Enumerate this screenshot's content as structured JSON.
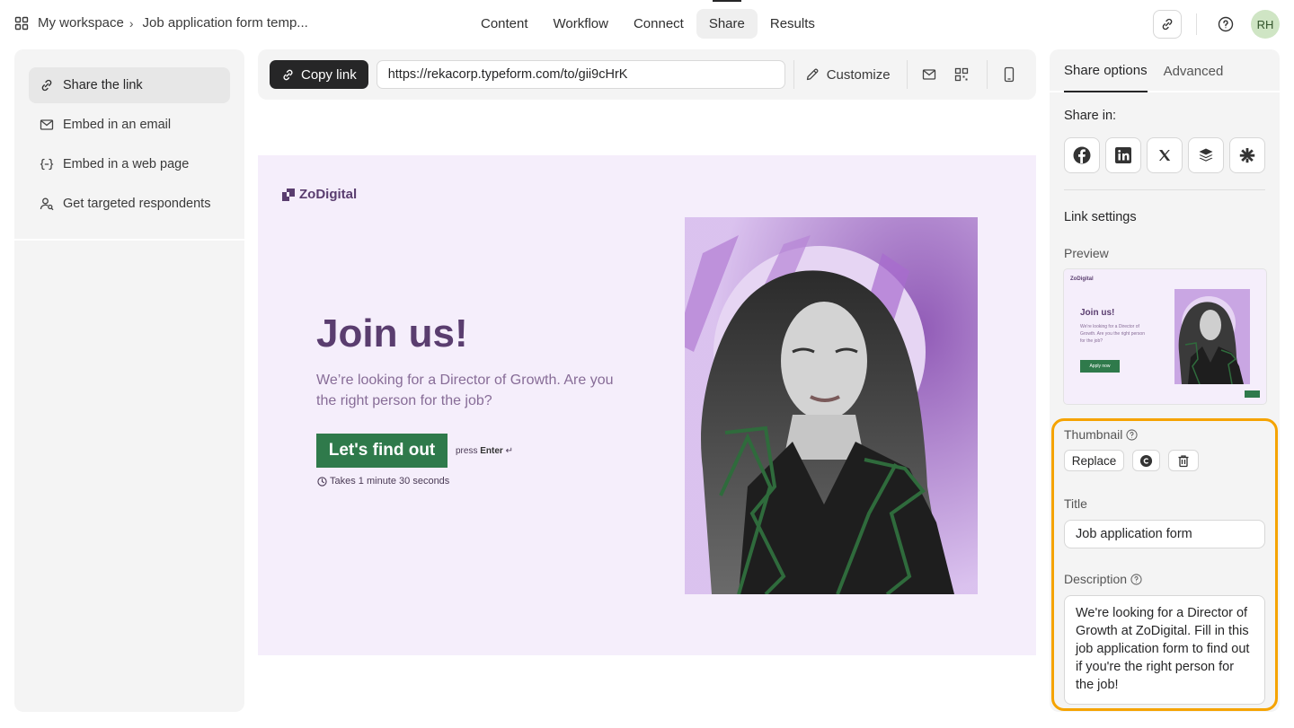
{
  "breadcrumb": {
    "workspace": "My workspace",
    "form": "Job application form temp..."
  },
  "topnav": {
    "tabs": [
      "Content",
      "Workflow",
      "Connect",
      "Share",
      "Results"
    ],
    "active": "Share"
  },
  "user": {
    "initials": "RH"
  },
  "left_menu": {
    "items": [
      {
        "label": "Share the link",
        "icon": "link-icon",
        "active": true
      },
      {
        "label": "Embed in an email",
        "icon": "mail-icon"
      },
      {
        "label": "Embed in a web page",
        "icon": "code-braces-icon"
      },
      {
        "label": "Get targeted respondents",
        "icon": "user-search-icon"
      }
    ]
  },
  "linkbar": {
    "copy_label": "Copy link",
    "url": "https://rekacorp.typeform.com/to/gii9cHrK",
    "customize_label": "Customize"
  },
  "form_preview": {
    "brand": "ZoDigital",
    "title": "Join us!",
    "subtitle": "We’re looking for a Director of Growth. Are you the right person for the job?",
    "cta": "Let's find out",
    "press_prefix": "press",
    "press_key": "Enter",
    "enter_glyph": "↵",
    "takes": "Takes 1 minute 30 seconds",
    "colors": {
      "background": "#f5eefb",
      "title": "#5a3d6f",
      "button": "#2f7a4b"
    }
  },
  "right_panel": {
    "tabs": [
      "Share options",
      "Advanced"
    ],
    "active_tab": "Share options",
    "share_in_label": "Share in:",
    "share_icons": [
      "facebook-icon",
      "linkedin-icon",
      "x-icon",
      "buffer-icon",
      "linktree-icon"
    ],
    "link_settings_label": "Link settings",
    "preview_label": "Preview",
    "mini": {
      "brand": "ZoDigital",
      "title": "Join us!",
      "subtitle": "We're looking for a Director of Growth. Are you the right person for the job?",
      "button": "Apply now"
    },
    "thumbnail_label": "Thumbnail",
    "replace_label": "Replace",
    "title_label": "Title",
    "title_value": "Job application form",
    "description_label": "Description",
    "description_value": "We're looking for a Director of Growth at ZoDigital. Fill in this job application form to find out if you're the right person for the job!",
    "highlight_color": "#f5a300"
  }
}
